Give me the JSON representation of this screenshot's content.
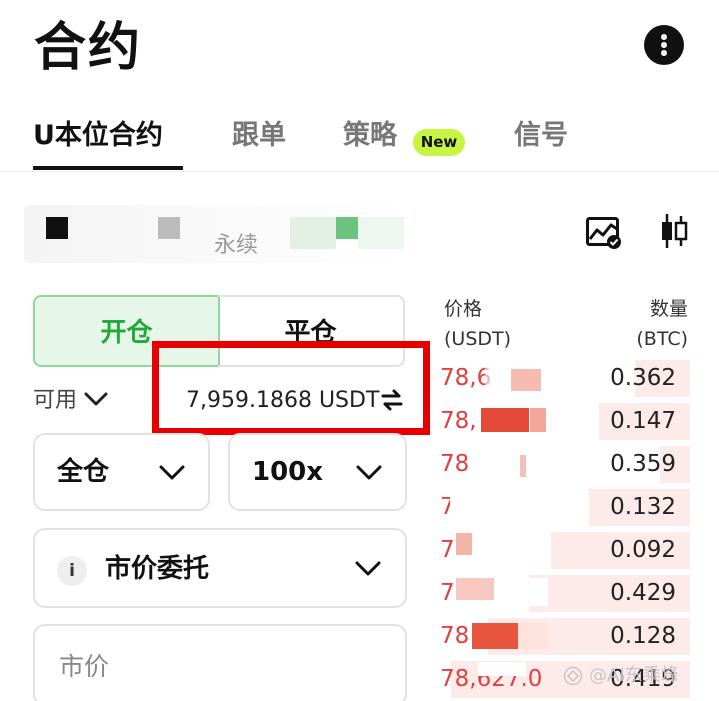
{
  "header": {
    "title": "合约"
  },
  "tabs": [
    {
      "label": "U本位合约",
      "active": true
    },
    {
      "label": "跟单"
    },
    {
      "label": "策略",
      "badge": "New"
    },
    {
      "label": "信号"
    }
  ],
  "symbol": {
    "visible_text": "永续"
  },
  "toolbar": {
    "chart_icon": "chart-check-icon",
    "candle_icon": "candlestick-icon"
  },
  "trade": {
    "open_label": "开仓",
    "close_label": "平仓",
    "available_label": "可用",
    "available_value": "7,959.1868 USDT",
    "margin_mode": "全仓",
    "leverage": "100x",
    "order_type": "市价委托",
    "price_placeholder": "市价",
    "info_icon_text": "i"
  },
  "orderbook": {
    "price_header": "价格",
    "price_unit": "(USDT)",
    "qty_header": "数量",
    "qty_unit": "(BTC)",
    "rows": [
      {
        "price": "78,6",
        "qty": "0.362",
        "depth": 0.22
      },
      {
        "price": "78,",
        "qty": "0.147",
        "depth": 0.36
      },
      {
        "price": "78",
        "qty": "0.359",
        "depth": 0.12
      },
      {
        "price": "7",
        "qty": "0.132",
        "depth": 0.4
      },
      {
        "price": "7",
        "qty": "0.092",
        "depth": 0.55
      },
      {
        "price": "7",
        "qty": "0.429",
        "depth": 0.64
      },
      {
        "price": "78",
        "qty": "0.128",
        "depth": 0.8
      },
      {
        "price": "78,627.0",
        "qty": "0.419",
        "depth": 0.95
      }
    ]
  },
  "watermark": {
    "text": "@AI东乘峰"
  },
  "colors": {
    "accent_green": "#21a93a",
    "ask_red": "#e0413f",
    "highlight_red": "#e60000",
    "badge_lime": "#c8f542"
  }
}
